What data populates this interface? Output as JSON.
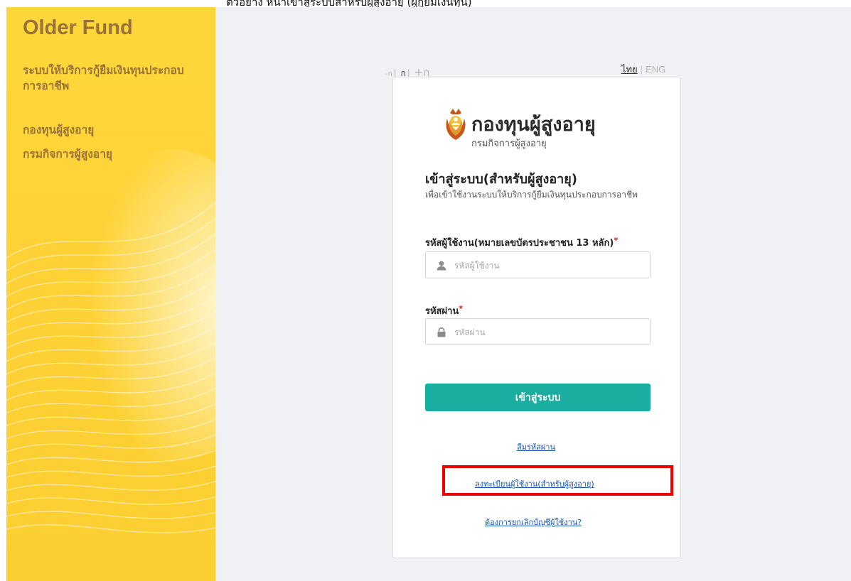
{
  "top_caption": "ตัวอย่าง หน้าเข้าสู่ระบบสำหรับผู้สูงอายุ (ผู้กู้ยืมเงินทุน)",
  "sidebar": {
    "brand": "Older Fund",
    "subtitle": "ระบบให้บริการกู้ยืมเงินทุนประกอบการอาชีพ",
    "links": [
      "กองทุนผู้สูงอายุ",
      "กรมกิจการผู้สูงอายุ"
    ]
  },
  "font_size": {
    "smaller": "-ก",
    "normal": "ก",
    "larger": "+ก"
  },
  "language": {
    "thai": "ไทย",
    "eng": "ENG"
  },
  "logo": {
    "title": "กองทุนผู้สูงอายุ",
    "subtitle": "กรมกิจการผู้สูงอายุ"
  },
  "login": {
    "title": "เข้าสู่ระบบ(สำหรับผู้สูงอายุ)",
    "description": "เพื่อเข้าใช้งานระบบให้บริการกู้ยืมเงินทุนประกอบการอาชีพ",
    "username_label": "รหัสผู้ใช้งาน(หมายเลขบัตรประชาชน 13 หลัก)",
    "username_placeholder": "รหัสผู้ใช้งาน",
    "password_label": "รหัสผ่าน",
    "password_placeholder": "รหัสผ่าน",
    "required_mark": "*",
    "submit": "เข้าสู่ระบบ",
    "forgot_password": "ลืมรหัสผ่าน",
    "register": "ลงทะเบียนผู้ใช้งาน(สำหรับผู้สูงอายุ)",
    "cancel_account": "ต้องการยกเลิกบัญชีผู้ใช้งาน?"
  },
  "colors": {
    "sidebar_bg": "#fdd73a",
    "sidebar_text": "#98723a",
    "button": "#1aaea1",
    "link": "#1a55b8",
    "highlight": "#ee0000"
  }
}
